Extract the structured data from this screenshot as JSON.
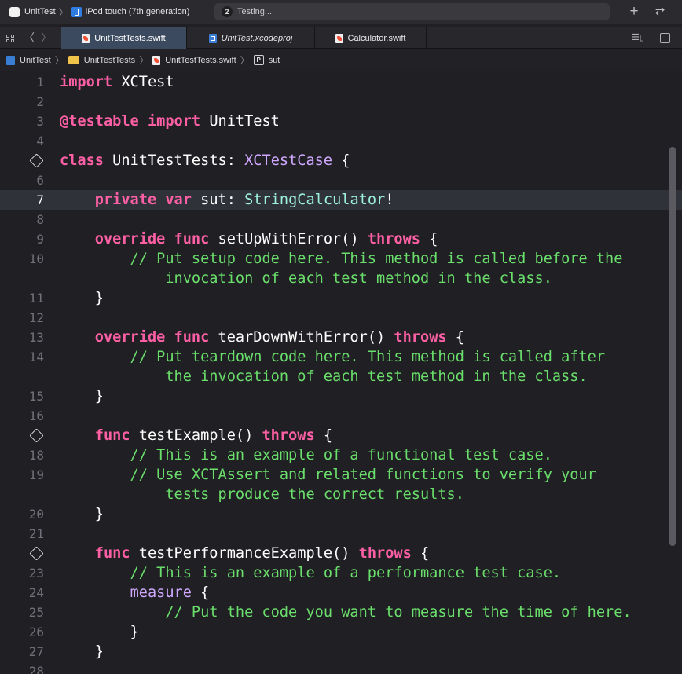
{
  "toolbar": {
    "scheme": "UnitTest",
    "device": "iPod touch (7th generation)",
    "activity_count": "2",
    "activity_text": "Testing...",
    "add_symbol": "+",
    "swap_symbol": "⇄"
  },
  "tabs": [
    {
      "label": "UnitTestTests.swift",
      "active": true
    },
    {
      "label": "UnitTest.xcodeproj",
      "active": false
    },
    {
      "label": "Calculator.swift",
      "active": false
    }
  ],
  "breadcrumb": [
    "UnitTest",
    "UnitTestTests",
    "UnitTestTests.swift",
    "sut"
  ],
  "breadcrumb_symbol": "P",
  "editor": {
    "current_line": "7",
    "lines": [
      {
        "n": "1",
        "segs": [
          {
            "t": "import",
            "c": "kw"
          },
          {
            "t": " XCTest"
          }
        ]
      },
      {
        "n": "2",
        "segs": []
      },
      {
        "n": "3",
        "segs": [
          {
            "t": "@testable",
            "c": "kw"
          },
          {
            "t": " "
          },
          {
            "t": "import",
            "c": "kw"
          },
          {
            "t": " UnitTest"
          }
        ]
      },
      {
        "n": "4",
        "segs": []
      },
      {
        "n": "",
        "diamond": true,
        "segs": [
          {
            "t": "class",
            "c": "kw"
          },
          {
            "t": " UnitTestTests: "
          },
          {
            "t": "XCTestCase",
            "c": "tp"
          },
          {
            "t": " {"
          }
        ]
      },
      {
        "n": "6",
        "segs": []
      },
      {
        "n": "7",
        "segs": [
          {
            "t": "    "
          },
          {
            "t": "private",
            "c": "kw"
          },
          {
            "t": " "
          },
          {
            "t": "var",
            "c": "kw"
          },
          {
            "t": " sut: "
          },
          {
            "t": "StringCalculator",
            "c": "ty"
          },
          {
            "t": "!"
          }
        ]
      },
      {
        "n": "8",
        "segs": []
      },
      {
        "n": "9",
        "segs": [
          {
            "t": "    "
          },
          {
            "t": "override",
            "c": "kw"
          },
          {
            "t": " "
          },
          {
            "t": "func",
            "c": "kw"
          },
          {
            "t": " setUpWithError() "
          },
          {
            "t": "throws",
            "c": "kw"
          },
          {
            "t": " {"
          }
        ]
      },
      {
        "n": "10",
        "segs": [
          {
            "t": "        // Put setup code here. This method is called before the",
            "c": "cm"
          }
        ]
      },
      {
        "n": "",
        "segs": [
          {
            "t": "            invocation of each test method in the class.",
            "c": "cm"
          }
        ]
      },
      {
        "n": "11",
        "segs": [
          {
            "t": "    }"
          }
        ]
      },
      {
        "n": "12",
        "segs": []
      },
      {
        "n": "13",
        "segs": [
          {
            "t": "    "
          },
          {
            "t": "override",
            "c": "kw"
          },
          {
            "t": " "
          },
          {
            "t": "func",
            "c": "kw"
          },
          {
            "t": " tearDownWithError() "
          },
          {
            "t": "throws",
            "c": "kw"
          },
          {
            "t": " {"
          }
        ]
      },
      {
        "n": "14",
        "segs": [
          {
            "t": "        // Put teardown code here. This method is called after",
            "c": "cm"
          }
        ]
      },
      {
        "n": "",
        "segs": [
          {
            "t": "            the invocation of each test method in the class.",
            "c": "cm"
          }
        ]
      },
      {
        "n": "15",
        "segs": [
          {
            "t": "    }"
          }
        ]
      },
      {
        "n": "16",
        "segs": []
      },
      {
        "n": "",
        "diamond": true,
        "segs": [
          {
            "t": "    "
          },
          {
            "t": "func",
            "c": "kw"
          },
          {
            "t": " testExample() "
          },
          {
            "t": "throws",
            "c": "kw"
          },
          {
            "t": " {"
          }
        ]
      },
      {
        "n": "18",
        "segs": [
          {
            "t": "        // This is an example of a functional test case.",
            "c": "cm"
          }
        ]
      },
      {
        "n": "19",
        "segs": [
          {
            "t": "        // Use XCTAssert and related functions to verify your",
            "c": "cm"
          }
        ]
      },
      {
        "n": "",
        "segs": [
          {
            "t": "            tests produce the correct results.",
            "c": "cm"
          }
        ]
      },
      {
        "n": "20",
        "segs": [
          {
            "t": "    }"
          }
        ]
      },
      {
        "n": "21",
        "segs": []
      },
      {
        "n": "",
        "diamond": true,
        "segs": [
          {
            "t": "    "
          },
          {
            "t": "func",
            "c": "kw"
          },
          {
            "t": " testPerformanceExample() "
          },
          {
            "t": "throws",
            "c": "kw"
          },
          {
            "t": " {"
          }
        ]
      },
      {
        "n": "23",
        "segs": [
          {
            "t": "        // This is an example of a performance test case.",
            "c": "cm"
          }
        ]
      },
      {
        "n": "24",
        "segs": [
          {
            "t": "        "
          },
          {
            "t": "measure",
            "c": "tp"
          },
          {
            "t": " {"
          }
        ]
      },
      {
        "n": "25",
        "segs": [
          {
            "t": "            // Put the code you want to measure the time of here.",
            "c": "cm"
          }
        ]
      },
      {
        "n": "26",
        "segs": [
          {
            "t": "        }"
          }
        ]
      },
      {
        "n": "27",
        "segs": [
          {
            "t": "    }"
          }
        ]
      },
      {
        "n": "28",
        "segs": []
      }
    ]
  }
}
